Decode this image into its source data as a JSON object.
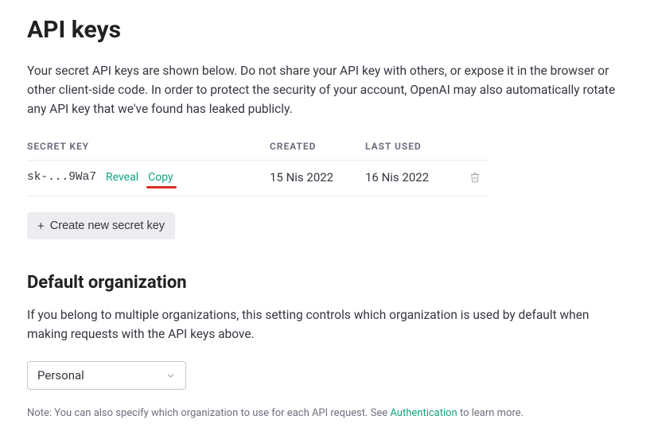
{
  "title": "API keys",
  "description": "Your secret API keys are shown below. Do not share your API key with others, or expose it in the browser or other client-side code. In order to protect the security of your account, OpenAI may also automatically rotate any API key that we've found has leaked publicly.",
  "table": {
    "headers": {
      "secret_key": "SECRET KEY",
      "created": "CREATED",
      "last_used": "LAST USED"
    },
    "rows": [
      {
        "key_masked": "sk-...9Wa7",
        "reveal": "Reveal",
        "copy": "Copy",
        "created": "15 Nis 2022",
        "last_used": "16 Nis 2022"
      }
    ]
  },
  "create_button": "Create new secret key",
  "org_section": {
    "heading": "Default organization",
    "description": "If you belong to multiple organizations, this setting controls which organization is used by default when making requests with the API keys above.",
    "selected": "Personal",
    "note_prefix": "Note: You can also specify which organization to use for each API request. See ",
    "note_link": "Authentication",
    "note_suffix": " to learn more."
  }
}
